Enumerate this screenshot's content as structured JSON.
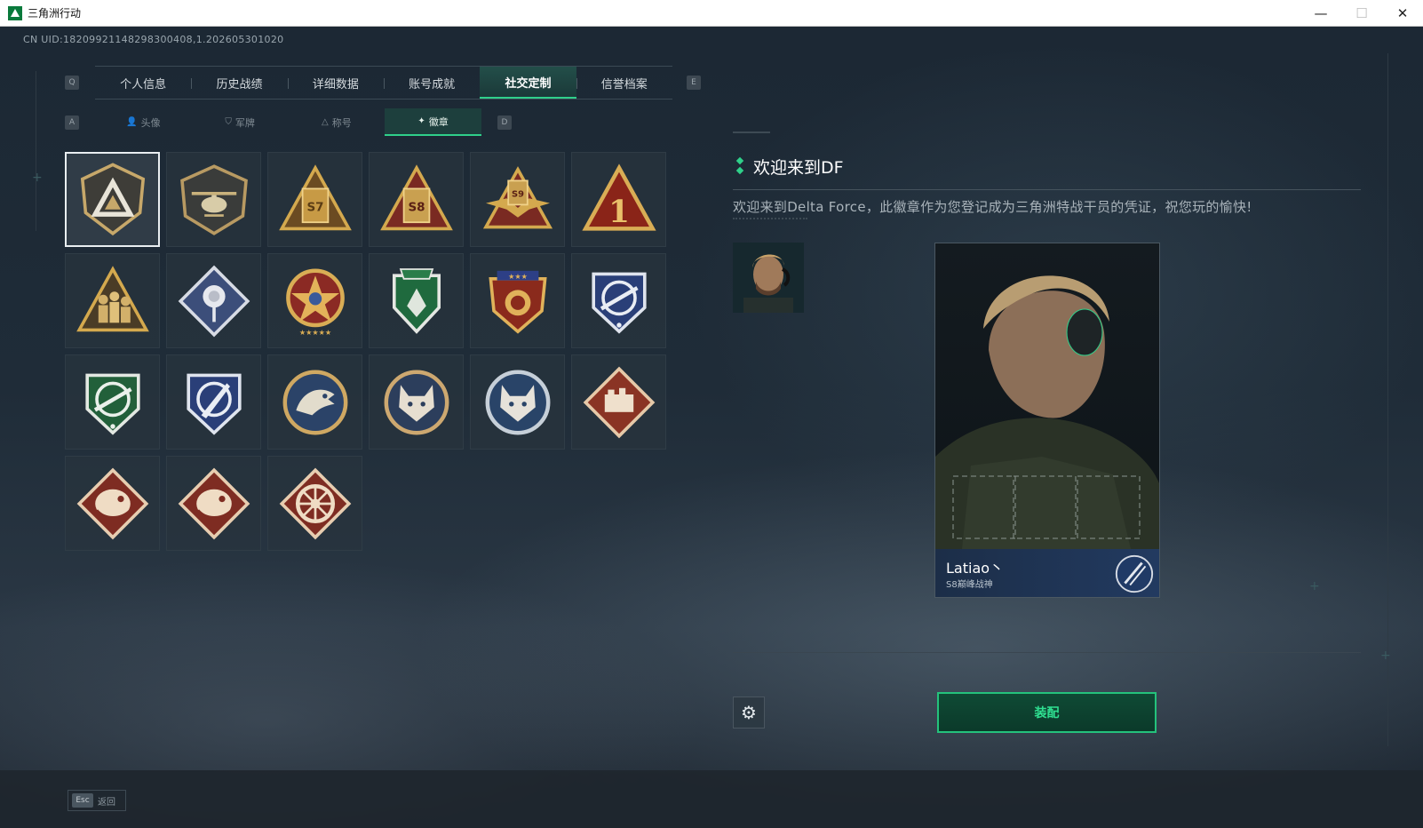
{
  "window": {
    "title": "三角洲行动",
    "minimize": "—",
    "maximize": "☐",
    "close": "✕"
  },
  "header": {
    "uid": "CN UID:18209921148298300408,1.202605301020"
  },
  "tabs": {
    "prev_key": "Q",
    "next_key": "E",
    "items": [
      {
        "label": "个人信息"
      },
      {
        "label": "历史战绩"
      },
      {
        "label": "详细数据"
      },
      {
        "label": "账号成就"
      },
      {
        "label": "社交定制"
      },
      {
        "label": "信誉档案"
      }
    ],
    "active_index": 4
  },
  "subtabs": {
    "prev_key": "A",
    "next_key": "D",
    "items": [
      {
        "label": "头像",
        "icon": "person-icon"
      },
      {
        "label": "军牌",
        "icon": "dogtag-icon"
      },
      {
        "label": "称号",
        "icon": "title-icon"
      },
      {
        "label": "徽章",
        "icon": "badge-icon"
      }
    ],
    "active_index": 3
  },
  "badges": [
    {
      "name": "delta-shield-badge"
    },
    {
      "name": "helicopter-badge"
    },
    {
      "name": "s7-badge",
      "text": "S7"
    },
    {
      "name": "s8-badge",
      "text": "S8"
    },
    {
      "name": "s9-badge",
      "text": "S9"
    },
    {
      "name": "rank-1-badge",
      "text": "1"
    },
    {
      "name": "soldiers-badge"
    },
    {
      "name": "rose-badge"
    },
    {
      "name": "star-emblem-badge"
    },
    {
      "name": "green-shield-badge"
    },
    {
      "name": "gold-crest-badge"
    },
    {
      "name": "blue-rifle-badge"
    },
    {
      "name": "green-rifle-badge"
    },
    {
      "name": "blue-knife-badge"
    },
    {
      "name": "eagle-badge"
    },
    {
      "name": "lynx-badge"
    },
    {
      "name": "lynx-blue-badge"
    },
    {
      "name": "red-diamond-badge"
    },
    {
      "name": "serpent-badge"
    },
    {
      "name": "serpent-2-badge"
    },
    {
      "name": "wheel-badge"
    }
  ],
  "detail": {
    "title": "欢迎来到DF",
    "description": "欢迎来到Delta Force，此徽章作为您登记成为三角洲特战干员的凭证，祝您玩的愉快!"
  },
  "card": {
    "player_name": "Latiao丶",
    "player_subtitle": "S8巅峰战神"
  },
  "actions": {
    "equip_label": "装配",
    "settings_icon": "gear-icon"
  },
  "footer": {
    "esc_key": "Esc",
    "back_label": "返回"
  }
}
